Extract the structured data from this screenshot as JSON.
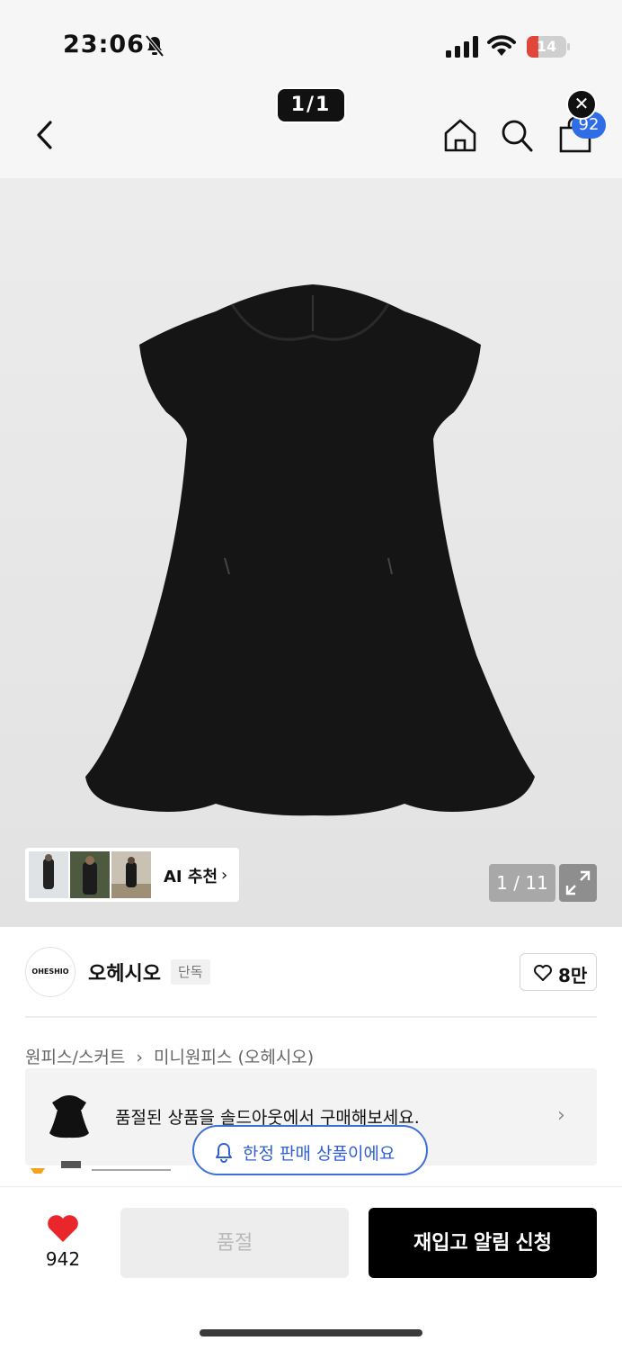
{
  "status_bar": {
    "time": "23:06",
    "battery": "14",
    "battery_level": 0.14
  },
  "header": {
    "image_position": "1/1",
    "cart_count": "92",
    "close_label": "✕"
  },
  "gallery": {
    "ai_label": "AI 추천",
    "counter": "1 / 11"
  },
  "brand": {
    "logo_text": "OHESHIO",
    "name": "오헤시오",
    "tag": "단독",
    "likes": "8만"
  },
  "breadcrumb": [
    "원피스/스커트",
    "›",
    "미니원피스 (오헤시오)"
  ],
  "soldout_banner": {
    "text": "품절된 상품을 솔드아웃에서 구매해보세요."
  },
  "limited": {
    "text": "한정 판매 상품이에요"
  },
  "bottom_bar": {
    "wish_count": "942",
    "soldout_label": "품절",
    "restock_label": "재입고 알림 신청"
  },
  "colors": {
    "accent_blue": "#2f6de6",
    "heart_red": "#e8262c",
    "primary_black": "#000000"
  }
}
